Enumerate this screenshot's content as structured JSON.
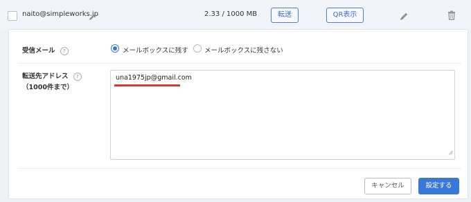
{
  "account": {
    "email": "naito@simpleworks.jp",
    "usage": "2.33 / 1000 MB",
    "forward_label": "転送",
    "qr_label": "QR表示"
  },
  "form": {
    "receive_label": "受信メール",
    "keep_option": "メールボックスに残す",
    "nokeep_option": "メールボックスに残さない",
    "selected": "keep",
    "forward_label": "転送先アドレス",
    "forward_limit": "（1000件まで）",
    "forward_value": "una1975jp@gmail.com",
    "help_glyph": "?"
  },
  "actions": {
    "cancel_label": "キャンセル",
    "save_label": "設定する"
  },
  "colors": {
    "accent": "#3a78d8",
    "highlight": "#d9392b"
  },
  "icons": [
    "pencil-icon",
    "trash-icon",
    "help-icon",
    "resize-handle-icon"
  ]
}
